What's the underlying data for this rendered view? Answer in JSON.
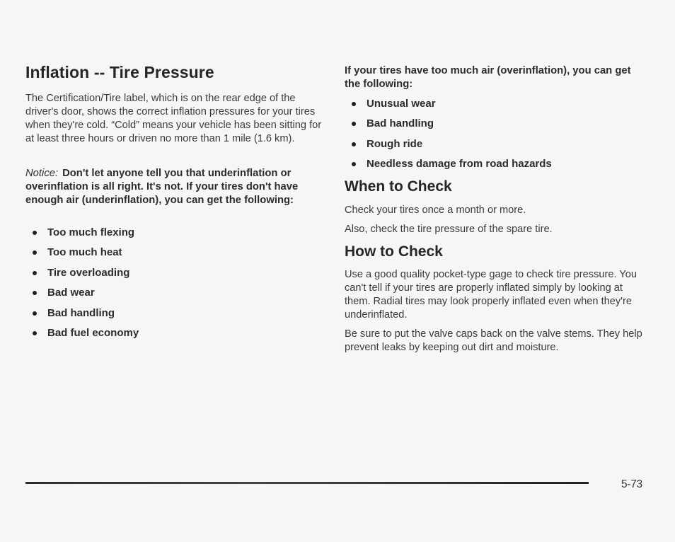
{
  "left": {
    "title": "Inflation -- Tire Pressure",
    "intro": "The Certification/Tire label, which is on the rear edge of the driver's door, shows the correct inflation pressures for your tires when they're cold. “Cold” means your vehicle has been sitting for at least three hours or driven no more than 1 mile (1.6 km).",
    "notice_label": "Notice:",
    "notice_text": "Don't let anyone tell you that underinflation or overinflation is all right. It's not. If your tires don't have enough air (underinflation), you can get the following:",
    "underinflation_effects": [
      "Too much flexing",
      "Too much heat",
      "Tire overloading",
      "Bad wear",
      "Bad handling",
      "Bad fuel economy"
    ]
  },
  "right": {
    "overinflation_intro": "If your tires have too much air (overinflation), you can get the following:",
    "overinflation_effects": [
      "Unusual wear",
      "Bad handling",
      "Rough ride",
      "Needless damage from road hazards"
    ],
    "when_title": "When to Check",
    "when_para_1": "Check your tires once a month or more.",
    "when_para_2": "Also, check the tire pressure of the spare tire.",
    "how_title": "How to Check",
    "how_para_1": "Use a good quality pocket-type gage to check tire pressure. You can't tell if your tires are properly inflated simply by looking at them. Radial tires may look properly inflated even when they're underinflated.",
    "how_para_2": "Be sure to put the valve caps back on the valve stems. They help prevent leaks by keeping out dirt and moisture."
  },
  "footer": {
    "page_number": "5-73"
  }
}
